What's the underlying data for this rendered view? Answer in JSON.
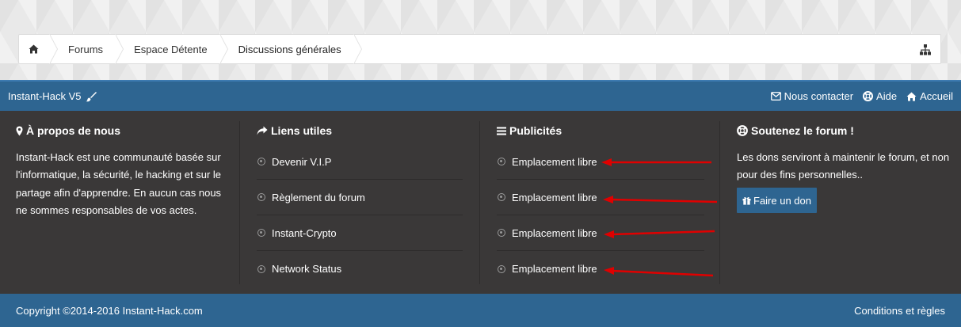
{
  "breadcrumb": {
    "items": [
      {
        "label": "Forums"
      },
      {
        "label": "Espace Détente"
      },
      {
        "label": "Discussions générales"
      }
    ]
  },
  "topbar": {
    "brand": "Instant-Hack V5",
    "links": [
      {
        "label": "Nous contacter",
        "icon": "envelope-icon"
      },
      {
        "label": "Aide",
        "icon": "lifebuoy-icon"
      },
      {
        "label": "Accueil",
        "icon": "home-icon"
      }
    ]
  },
  "footer": {
    "about": {
      "title": "À propos de nous",
      "text": "Instant-Hack est une communauté basée sur l'informatique, la sécurité, le hacking et sur le partage afin d'apprendre. En aucun cas nous ne sommes responsables de vos actes."
    },
    "useful_links": {
      "title": "Liens utiles",
      "items": [
        {
          "label": "Devenir V.I.P"
        },
        {
          "label": "Règlement du forum"
        },
        {
          "label": "Instant-Crypto"
        },
        {
          "label": "Network Status"
        }
      ]
    },
    "ads": {
      "title": "Publicités",
      "items": [
        {
          "label": "Emplacement libre"
        },
        {
          "label": "Emplacement libre"
        },
        {
          "label": "Emplacement libre"
        },
        {
          "label": "Emplacement libre"
        }
      ]
    },
    "support": {
      "title": "Soutenez le forum !",
      "text": "Les dons serviront à maintenir le forum, et non pour des fins personnelles..",
      "button": "Faire un don"
    }
  },
  "bottombar": {
    "copyright": "Copyright ©2014-2016 Instant-Hack.com",
    "conditions": "Conditions et règles"
  },
  "colors": {
    "accent_blue": "#2e6591",
    "footer_bg": "#3a3838",
    "arrow_red": "#e00000"
  }
}
